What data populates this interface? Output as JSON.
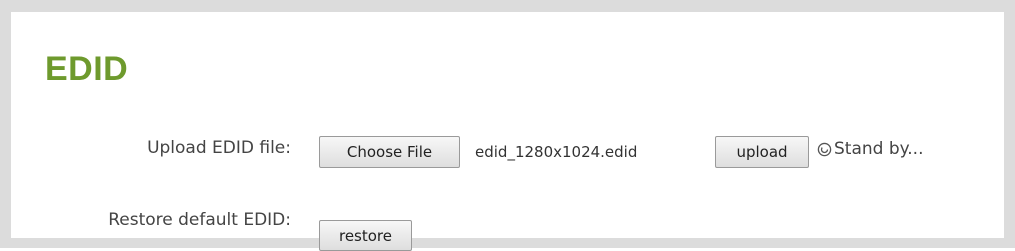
{
  "section": {
    "title": "EDID"
  },
  "upload": {
    "label": "Upload EDID file:",
    "choose_button_label": "Choose File",
    "selected_filename": "edid_1280x1024.edid",
    "upload_button_label": "upload",
    "status_icon": "busy-spinner-icon",
    "status_text": "Stand by..."
  },
  "restore": {
    "label": "Restore default EDID:",
    "button_label": "restore"
  },
  "colors": {
    "title": "#6e9a2d",
    "frame": "#dcdcdc",
    "text": "#444444"
  }
}
